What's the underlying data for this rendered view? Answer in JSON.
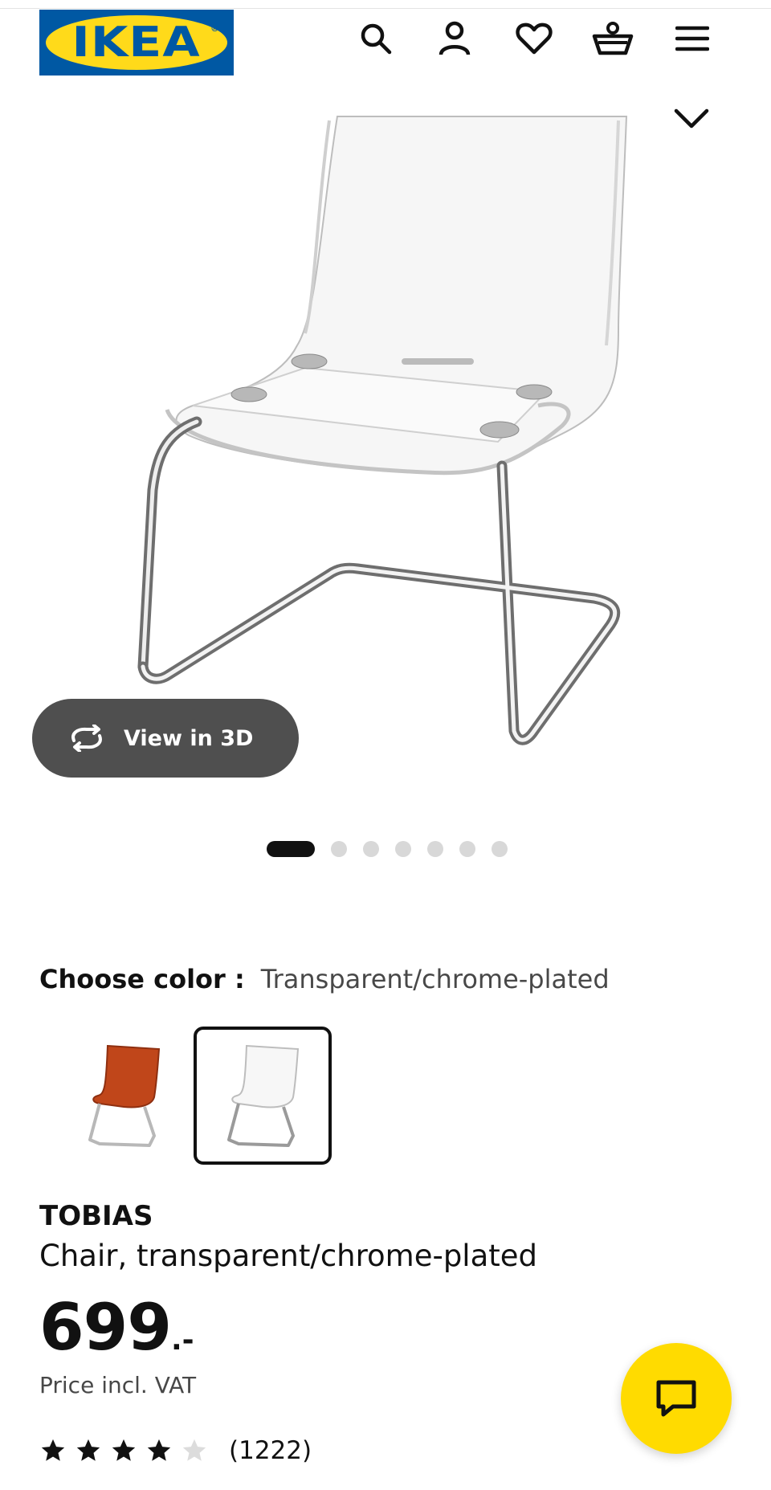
{
  "header": {
    "logo_text": "IKEA",
    "logo_mark": "®",
    "icons": [
      "search-icon",
      "account-icon",
      "heart-icon",
      "basket-icon",
      "menu-icon"
    ]
  },
  "gallery": {
    "view3d_label": "View in 3D",
    "slide_count": 7,
    "active_slide": 1
  },
  "color_chooser": {
    "label": "Choose color :",
    "value": "Transparent/chrome-plated",
    "options": [
      "orange-red chair thumbnail",
      "transparent chair thumbnail"
    ],
    "selected_option": 2
  },
  "product": {
    "name": "TOBIAS",
    "description": "Chair, transparent/chrome-plated",
    "price": "699",
    "price_suffix": ".-",
    "price_note": "Price incl. VAT"
  },
  "rating": {
    "stars": 4,
    "max_stars": 5,
    "count": "(1222)"
  },
  "colors": {
    "ikea_blue": "#0058a3",
    "ikea_yellow": "#ffda1a",
    "chat_yellow": "#ffdb00",
    "text_dark": "#111111",
    "text_grey": "#484848"
  }
}
